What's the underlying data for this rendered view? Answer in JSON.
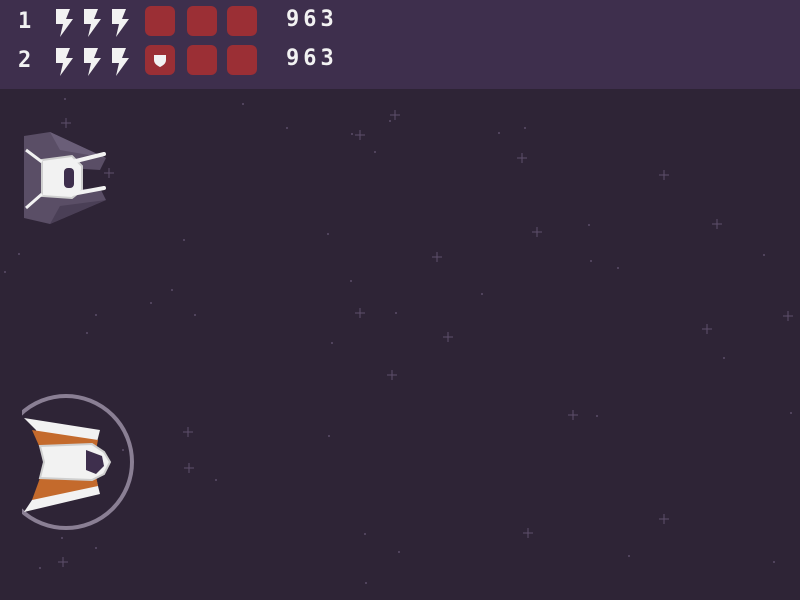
{
  "players": [
    {
      "number": "1",
      "energy_icons": [
        "lightning-icon",
        "lightning-icon",
        "lightning-icon"
      ],
      "slots": [
        {
          "filled": false
        },
        {
          "filled": false
        },
        {
          "filled": false
        }
      ],
      "score": "963"
    },
    {
      "number": "2",
      "energy_icons": [
        "lightning-icon",
        "lightning-icon",
        "lightning-icon"
      ],
      "slots": [
        {
          "filled": true,
          "icon": "shield-icon"
        },
        {
          "filled": false
        },
        {
          "filled": false
        }
      ],
      "score": "963"
    }
  ],
  "colors": {
    "hud_bg": "#3e2f4d",
    "space_bg": "#2e2436",
    "slot": "#9b2f35",
    "ship_orange": "#c46a2c",
    "ship_grey_wing": "#5a4e66",
    "shield_ring": "#8a7f94"
  }
}
